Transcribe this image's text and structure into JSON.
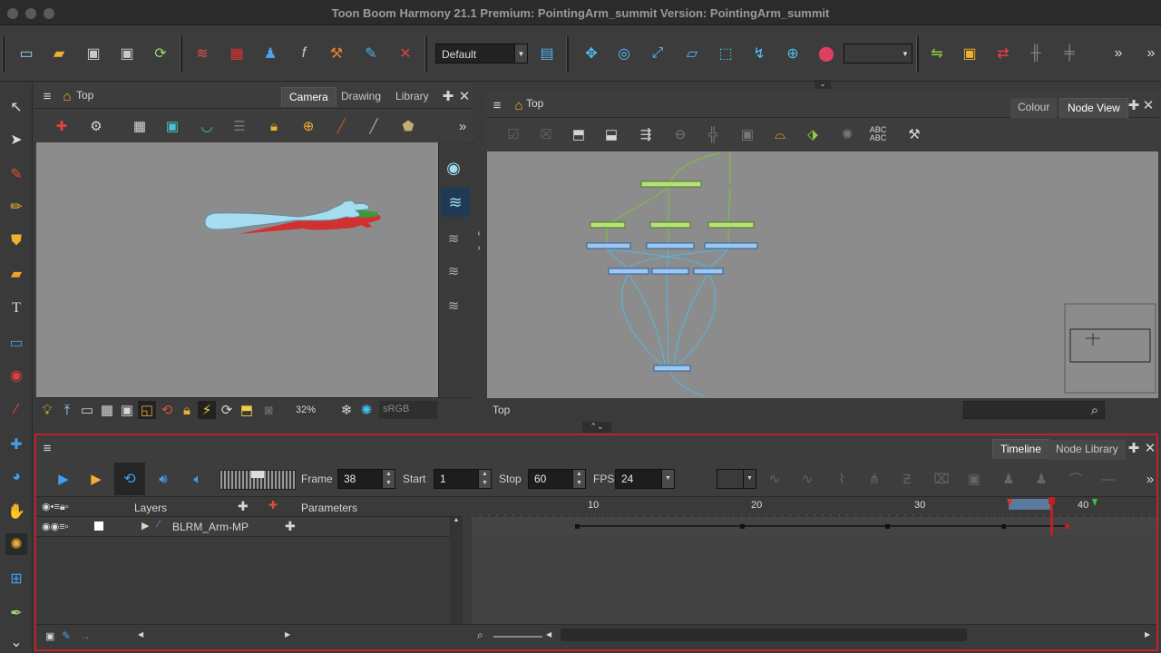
{
  "window": {
    "title": "Toon Boom Harmony 21.1 Premium: PointingArm_summit Version: PointingArm_summit"
  },
  "toolbar": {
    "workspace_value": "Default",
    "icons": [
      "new-icon",
      "open-icon",
      "save-icon",
      "save-as-icon",
      "import-icon",
      "layers-icon",
      "grid-icon",
      "peg-icon",
      "function-icon",
      "bone-icon",
      "magic-icon",
      "eraser-icon"
    ],
    "right_icons": [
      "transform-icon",
      "rotate-icon",
      "scale-icon",
      "skew-icon",
      "morph-icon",
      "deform-icon",
      "target-icon",
      "ik-icon",
      "more-icon"
    ]
  },
  "camera_panel": {
    "title": "Top",
    "tabs": [
      "Camera",
      "Drawing",
      "Library"
    ],
    "active_tab": "Camera",
    "zoom": "32%",
    "colour_space": "sRGB"
  },
  "node_panel": {
    "title": "Top",
    "tabs": [
      "Colour",
      "Node View"
    ],
    "active_tab": "Node View",
    "footer_label": "Top"
  },
  "timeline": {
    "tabs": [
      "Timeline",
      "Node Library"
    ],
    "active_tab": "Timeline",
    "frame_label": "Frame",
    "frame_value": "38",
    "start_label": "Start",
    "start_value": "1",
    "stop_label": "Stop",
    "stop_value": "60",
    "fps_label": "FPS",
    "fps_value": "24",
    "layers_header": "Layers",
    "parameters_header": "Parameters",
    "layer_name": "BLRM_Arm-MP",
    "ruler": [
      "10",
      "20",
      "30",
      "40"
    ],
    "current_frame": 38
  }
}
